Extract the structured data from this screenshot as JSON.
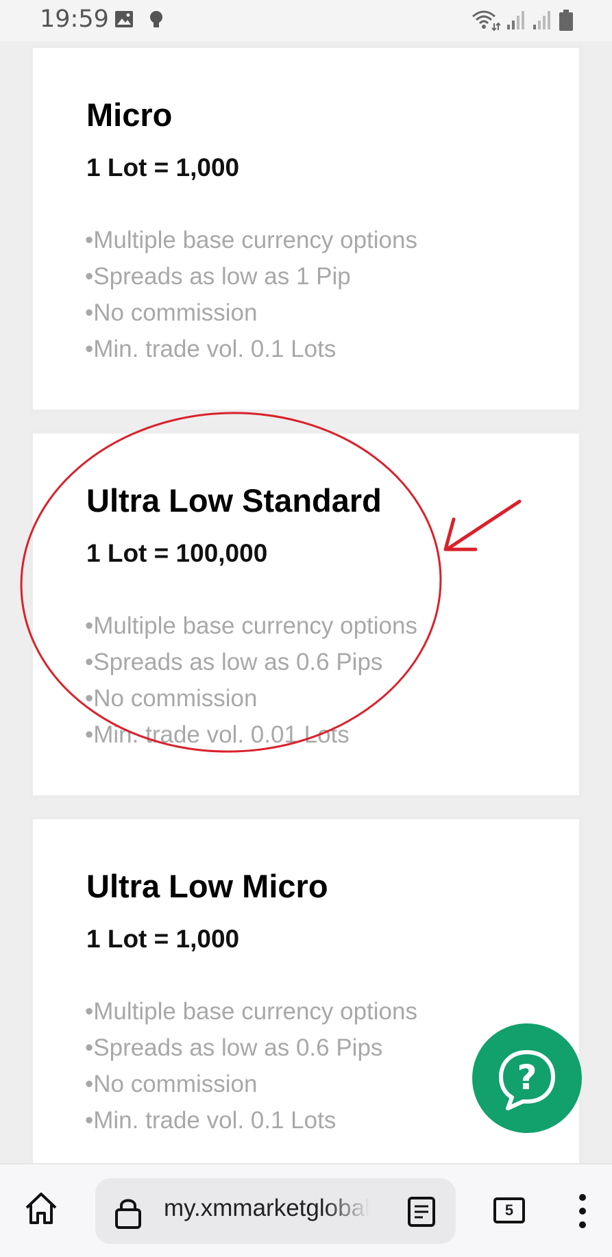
{
  "status_bar": {
    "time": "19:59",
    "icons": [
      "image-icon",
      "bulb-icon",
      "wifi-icon",
      "signal-icon",
      "signal-icon",
      "battery-icon"
    ]
  },
  "cards": [
    {
      "title": "Micro",
      "lot": "1 Lot = 1,000",
      "features": [
        "•Multiple base currency options",
        "•Spreads as low as 1 Pip",
        "•No commission",
        "•Min. trade vol. 0.1 Lots"
      ]
    },
    {
      "title": "Ultra Low Standard",
      "lot": "1 Lot = 100,000",
      "features": [
        "•Multiple base currency options",
        "•Spreads as low as 0.6 Pips",
        "•No commission",
        "•Min. trade vol. 0.01 Lots"
      ]
    },
    {
      "title": "Ultra Low Micro",
      "lot": "1 Lot = 1,000",
      "features": [
        "•Multiple base currency options",
        "•Spreads as low as 0.6 Pips",
        "•No commission",
        "•Min. trade vol. 0.1 Lots"
      ]
    }
  ],
  "help_button": {
    "icon": "help-chat-icon"
  },
  "annotation": {
    "color": "#d9212b",
    "shapes": [
      "circle",
      "arrow"
    ]
  },
  "browser_bar": {
    "url": "my.xmmarketglobal",
    "tab_count": "5",
    "icons": [
      "home-icon",
      "lock-icon",
      "reader-icon",
      "tabs-icon",
      "more-icon"
    ]
  },
  "colors": {
    "fab": "#12a06c",
    "feature_text": "#a8a8a8"
  }
}
